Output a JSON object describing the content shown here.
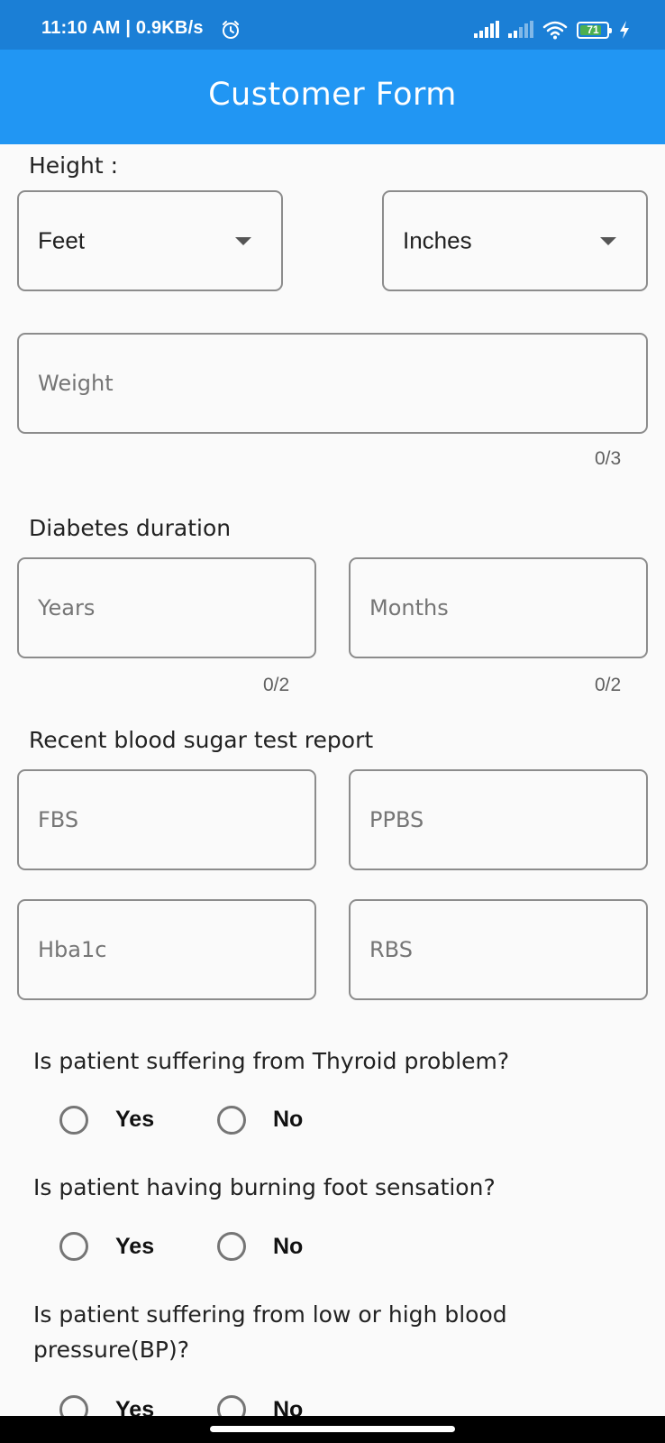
{
  "status_bar": {
    "time": "11:10 AM | 0.9KB/s",
    "battery_level": "71",
    "icons": [
      "alarm-icon",
      "signal-icon",
      "signal-weak-icon",
      "wifi-icon",
      "battery-icon",
      "charging-icon"
    ]
  },
  "app_bar": {
    "title": "Customer Form"
  },
  "height": {
    "label": "Height :",
    "feet_value": "Feet",
    "inches_value": "Inches"
  },
  "weight": {
    "placeholder": "Weight",
    "counter": "0/3"
  },
  "diabetes": {
    "label": "Diabetes duration",
    "years_placeholder": "Years",
    "years_counter": "0/2",
    "months_placeholder": "Months",
    "months_counter": "0/2"
  },
  "blood_sugar": {
    "label": "Recent blood sugar test report",
    "fbs": "FBS",
    "ppbs": "PPBS",
    "hba1c": "Hba1c",
    "rbs": "RBS"
  },
  "questions": [
    {
      "text": "Is patient suffering from Thyroid problem?",
      "yes": "Yes",
      "no": "No"
    },
    {
      "text": "Is patient having burning foot sensation?",
      "yes": "Yes",
      "no": "No"
    },
    {
      "text": "Is patient suffering from low or high blood pressure(BP)?",
      "yes": "Yes",
      "no": "No"
    }
  ],
  "colors": {
    "status_bar": "#1b7fd6",
    "app_bar": "#2196f3",
    "background": "#fafafa",
    "field_border": "#8c8c8c"
  }
}
